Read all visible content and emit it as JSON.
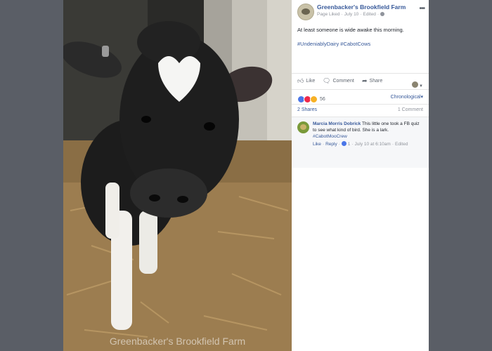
{
  "post": {
    "page_name": "Greenbacker's Brookfield Farm",
    "page_liked": "Page Liked",
    "date": "July 10",
    "edited": "Edited",
    "text": "At least someone is wide awake this morning.",
    "hashtags": [
      "#UndeniablyDairy",
      "#CabotCows"
    ],
    "watermark": "Greenbacker's Brookfield Farm"
  },
  "actions": {
    "like": "Like",
    "comment": "Comment",
    "share": "Share"
  },
  "reactions": {
    "count": "56",
    "sort_label": "Chronological",
    "types": [
      "like",
      "love",
      "haha"
    ]
  },
  "counts": {
    "shares": "2 Shares",
    "comments": "1 Comment"
  },
  "comment": {
    "author": "Marcia Morris Dobrick",
    "text": "This little one took a FB quiz to see what kind of bird. She is a lark.",
    "tag": "#CabotMooCrew",
    "like": "Like",
    "reply": "Reply",
    "likes": "1",
    "timestamp": "July 10 at 6:10am",
    "edited": "Edited"
  },
  "colors": {
    "link": "#365899",
    "backdrop": "#5a5e66",
    "like_blue": "#4a76e8",
    "love_red": "#f0284a",
    "haha_yellow": "#f7b125"
  }
}
